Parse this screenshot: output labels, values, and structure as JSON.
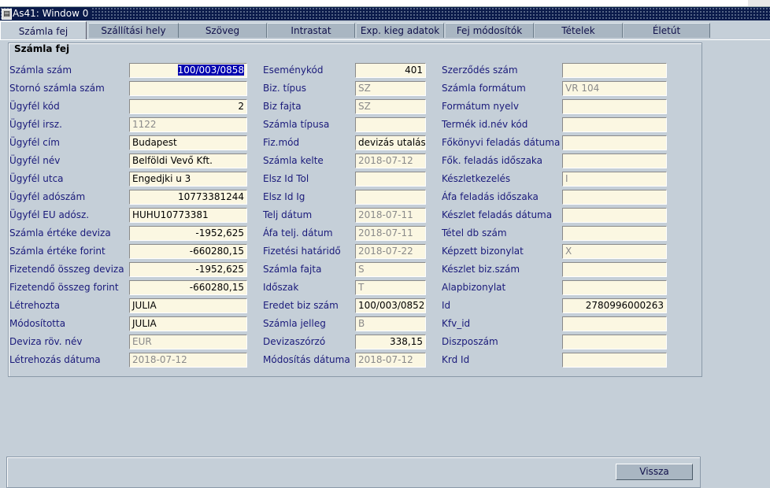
{
  "window": {
    "title": "As41: Window 0"
  },
  "tabs": [
    "Számla fej",
    "Szállítási hely",
    "Szöveg",
    "Intrastat",
    "Exp. kieg adatok",
    "Fej módosítók",
    "Tételek",
    "Életút"
  ],
  "panel": {
    "title": "Számla fej"
  },
  "col1": [
    {
      "label": "Számla szám",
      "value": "100/003/0858"
    },
    {
      "label": "Stornó számla szám",
      "value": ""
    },
    {
      "label": "Ügyfél kód",
      "value": "2"
    },
    {
      "label": "Ügyfél irsz.",
      "value": "1122"
    },
    {
      "label": "Ügyfél cím",
      "value": "Budapest"
    },
    {
      "label": "Ügyfél név",
      "value": "Belföldi Vevő Kft."
    },
    {
      "label": "Ügyfél utca",
      "value": "Engedjki u 3"
    },
    {
      "label": "Ügyfél adószám",
      "value": "10773381244"
    },
    {
      "label": "Ügyfél EU adósz.",
      "value": "HUHU10773381"
    },
    {
      "label": "Számla értéke deviza",
      "value": "-1952,625"
    },
    {
      "label": "Számla értéke forint",
      "value": "-660280,15"
    },
    {
      "label": "Fizetendő összeg deviza",
      "value": "-1952,625"
    },
    {
      "label": "Fizetendő összeg forint",
      "value": "-660280,15"
    },
    {
      "label": "Létrehozta",
      "value": "JULIA"
    },
    {
      "label": "Módosította",
      "value": "JULIA"
    },
    {
      "label": "Deviza röv. név",
      "value": "EUR"
    },
    {
      "label": "Létrehozás dátuma",
      "value": "2018-07-12"
    }
  ],
  "col2": [
    {
      "label": "Eseménykód",
      "value": "401"
    },
    {
      "label": "Biz. típus",
      "value": "SZ"
    },
    {
      "label": "Biz fajta",
      "value": "SZ"
    },
    {
      "label": "Számla típusa",
      "value": ""
    },
    {
      "label": "Fiz.mód",
      "value": "devizás utalás"
    },
    {
      "label": "Számla kelte",
      "value": "2018-07-12"
    },
    {
      "label": "Elsz Id Tol",
      "value": ""
    },
    {
      "label": "Elsz Id Ig",
      "value": ""
    },
    {
      "label": "Telj dátum",
      "value": "2018-07-11"
    },
    {
      "label": "Áfa telj. dátum",
      "value": "2018-07-11"
    },
    {
      "label": "Fizetési határidő",
      "value": "2018-07-22"
    },
    {
      "label": "Számla fajta",
      "value": "S"
    },
    {
      "label": "Időszak",
      "value": "T"
    },
    {
      "label": "Eredet biz szám",
      "value": "100/003/0852"
    },
    {
      "label": "Számla jelleg",
      "value": "B"
    },
    {
      "label": "Devizaszórzó",
      "value": "338,15"
    },
    {
      "label": "Módosítás dátuma",
      "value": "2018-07-12"
    }
  ],
  "col3": [
    {
      "label": "Szerződés szám",
      "value": ""
    },
    {
      "label": "Számla formátum",
      "value": "VR 104"
    },
    {
      "label": "Formátum nyelv",
      "value": ""
    },
    {
      "label": "Termék id.név kód",
      "value": ""
    },
    {
      "label": "Főkönyvi feladás dátuma",
      "value": ""
    },
    {
      "label": "Fők. feladás időszaka",
      "value": ""
    },
    {
      "label": "Készletkezelés",
      "value": "I"
    },
    {
      "label": "Áfa feladás időszaka",
      "value": ""
    },
    {
      "label": "Készlet feladás dátuma",
      "value": ""
    },
    {
      "label": "Tétel db szám",
      "value": ""
    },
    {
      "label": "Képzett bizonylat",
      "value": "X"
    },
    {
      "label": "Készlet biz.szám",
      "value": ""
    },
    {
      "label": "Alapbizonylat",
      "value": ""
    },
    {
      "label": "Id",
      "value": "2780996000263"
    },
    {
      "label": "Kfv_id",
      "value": ""
    },
    {
      "label": "Diszposzám",
      "value": ""
    },
    {
      "label": "Krd Id",
      "value": ""
    }
  ],
  "buttons": {
    "back": "Vissza"
  }
}
